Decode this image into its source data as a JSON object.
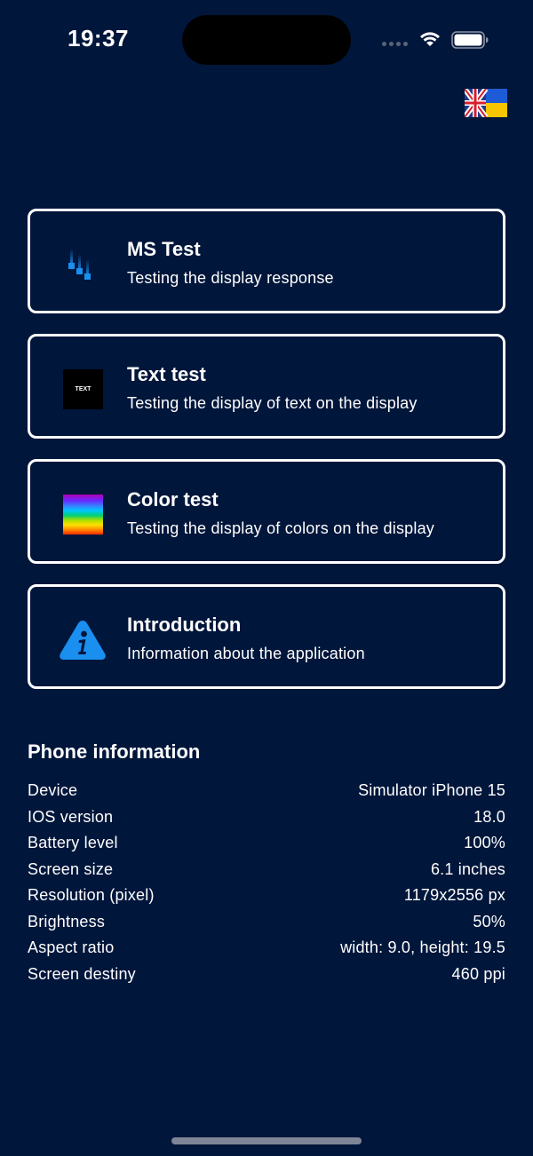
{
  "status_bar": {
    "time": "19:37",
    "signal_icon": "signal-dots-icon",
    "wifi_icon": "wifi-icon",
    "battery_icon": "battery-full-icon"
  },
  "language_flag_icon": "uk-ukraine-flag-icon",
  "menu": [
    {
      "title": "MS Test",
      "subtitle": "Testing the display response",
      "icon": "ms-bars-icon"
    },
    {
      "title": "Text test",
      "subtitle": "Testing the display of text on the display",
      "icon": "text-icon",
      "icon_text": "TEXT"
    },
    {
      "title": "Color test",
      "subtitle": "Testing the display of colors on the display",
      "icon": "rainbow-icon"
    },
    {
      "title": "Introduction",
      "subtitle": "Information about the application",
      "icon": "info-warning-icon"
    }
  ],
  "phone_info": {
    "heading": "Phone information",
    "rows": [
      {
        "label": "Device",
        "value": "Simulator iPhone 15"
      },
      {
        "label": "IOS version",
        "value": "18.0"
      },
      {
        "label": "Battery level",
        "value": "100%"
      },
      {
        "label": "Screen size",
        "value": "6.1 inches"
      },
      {
        "label": "Resolution (pixel)",
        "value": "1179x2556 px"
      },
      {
        "label": "Brightness",
        "value": "50%"
      },
      {
        "label": "Aspect ratio",
        "value": "width: 9.0, height: 19.5"
      },
      {
        "label": "Screen destiny",
        "value": "460 ppi"
      }
    ]
  },
  "colors": {
    "background": "#01163b",
    "accent_blue": "#1a8ff0",
    "text": "#ffffff"
  }
}
